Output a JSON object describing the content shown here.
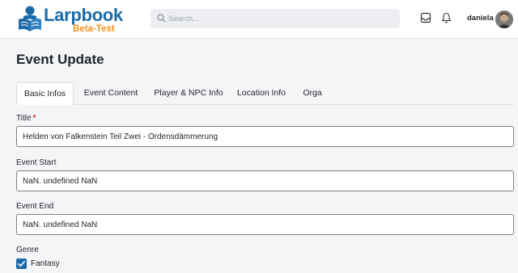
{
  "app": {
    "logo_text": "Larpbook",
    "logo_sub": "Beta-Test"
  },
  "search": {
    "placeholder": "Search...",
    "icon": "search-icon"
  },
  "user": {
    "name": "daniela"
  },
  "header_icons": [
    "inbox-icon",
    "bell-icon"
  ],
  "page": {
    "title": "Event Update"
  },
  "tabs": [
    {
      "label": "Basic Infos",
      "active": true
    },
    {
      "label": "Event Content",
      "active": false
    },
    {
      "label": "Player & NPC Info",
      "active": false
    },
    {
      "label": "Location Info",
      "active": false
    },
    {
      "label": "Orga",
      "active": false
    }
  ],
  "form": {
    "title": {
      "label": "Title",
      "required_mark": "*",
      "value": "Helden von Falkenstein Teil Zwei - Ordensdämmerung"
    },
    "event_start": {
      "label": "Event Start",
      "value": "NaN. undefined NaN"
    },
    "event_end": {
      "label": "Event End",
      "value": "NaN. undefined NaN"
    },
    "genre": {
      "label": "Genre",
      "options": [
        {
          "label": "Fantasy",
          "checked": true
        }
      ]
    }
  },
  "colors": {
    "brand_blue": "#1b6aa8",
    "brand_orange": "#f0941e",
    "required_red": "#d63333",
    "checkbox_blue": "#1f6aa6"
  }
}
